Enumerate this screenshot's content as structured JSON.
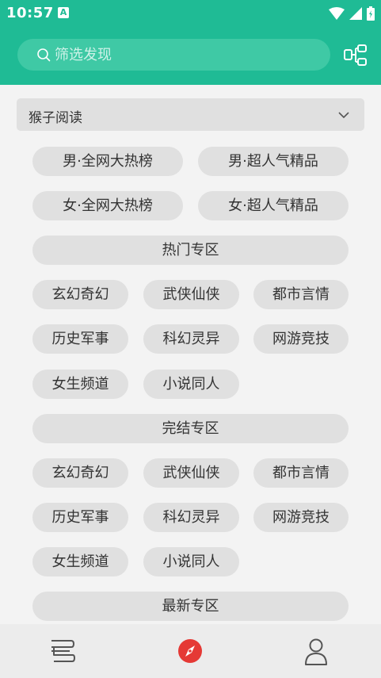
{
  "status_bar": {
    "time": "10:57",
    "notification_badge": "A"
  },
  "search": {
    "placeholder": "筛选发现"
  },
  "source_select": {
    "selected": "猴子阅读"
  },
  "rows": {
    "ranking_1": [
      "男·全网大热榜",
      "男·超人气精品"
    ],
    "ranking_2": [
      "女·全网大热榜",
      "女·超人气精品"
    ],
    "hot_section": "热门专区",
    "hot_row_1": [
      "玄幻奇幻",
      "武侠仙侠",
      "都市言情"
    ],
    "hot_row_2": [
      "历史军事",
      "科幻灵异",
      "网游竞技"
    ],
    "hot_row_3": [
      "女生频道",
      "小说同人"
    ],
    "finished_section": "完结专区",
    "finished_row_1": [
      "玄幻奇幻",
      "武侠仙侠",
      "都市言情"
    ],
    "finished_row_2": [
      "历史军事",
      "科幻灵异",
      "网游竞技"
    ],
    "finished_row_3": [
      "女生频道",
      "小说同人"
    ],
    "latest_section": "最新专区"
  },
  "bottom_nav": [
    "bookshelf-icon",
    "discover-compass-icon",
    "profile-icon"
  ],
  "colors": {
    "accent": "#1fbb95",
    "search_bg": "#3fc9a5",
    "chip_bg": "#e0e0e0",
    "active_nav": "#e53935"
  }
}
